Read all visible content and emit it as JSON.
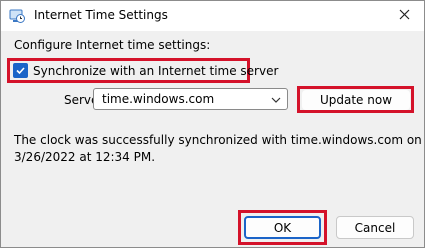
{
  "window": {
    "title": "Internet Time Settings",
    "icon": "clock-globe-icon"
  },
  "content": {
    "section_label": "Configure Internet time settings:",
    "sync_checkbox": {
      "label": "Synchronize with an Internet time server",
      "checked": true
    },
    "server": {
      "label": "Server:",
      "value": "time.windows.com"
    },
    "update_button": "Update now",
    "status_line1": "The clock was successfully synchronized with time.windows.com on",
    "status_line2": "3/26/2022 at 12:34 PM."
  },
  "buttons": {
    "ok": "OK",
    "cancel": "Cancel"
  },
  "colors": {
    "highlight": "#d4122a",
    "accent": "#1b64c8"
  }
}
